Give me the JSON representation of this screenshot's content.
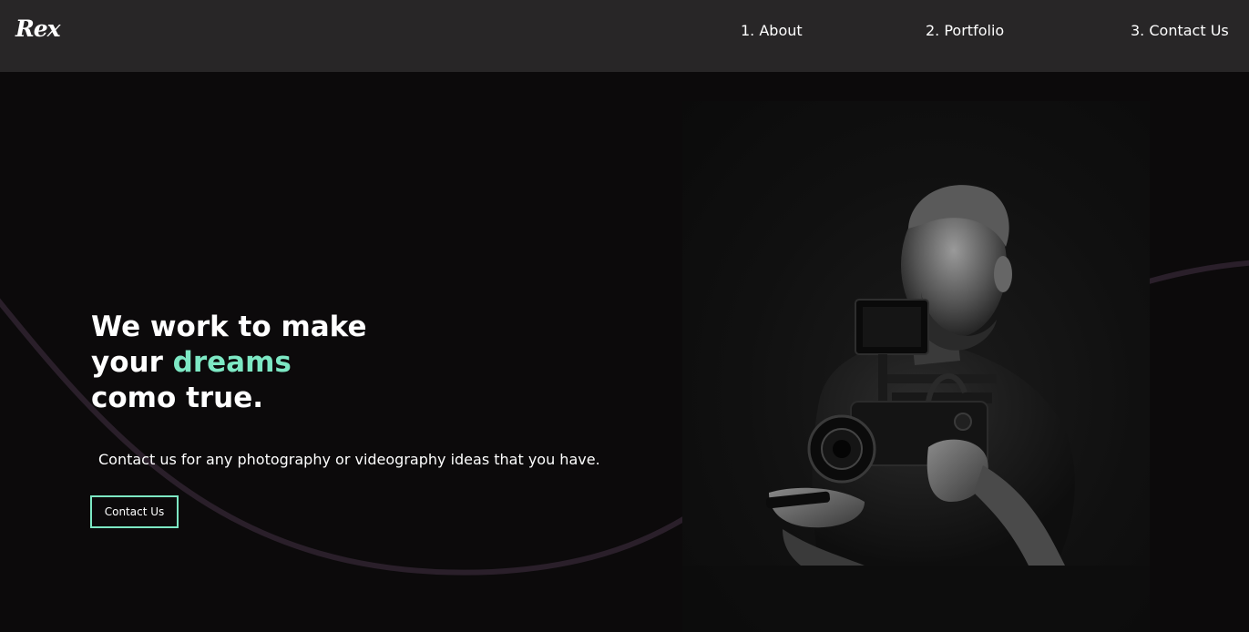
{
  "brand": {
    "logo_text": "Rex"
  },
  "nav": {
    "items": [
      {
        "label": "1. About"
      },
      {
        "label": "2. Portfolio"
      },
      {
        "label": "3. Contact Us"
      }
    ]
  },
  "hero": {
    "title_line1": "We work to make",
    "title_line2_prefix": "your ",
    "title_accent": "dreams",
    "title_line3": "como true.",
    "subtitle": "Contact us for any photography or videography ideas that you have.",
    "cta_label": "Contact Us"
  },
  "colors": {
    "accent": "#7de8c4",
    "navbar_bg": "#282627",
    "page_bg": "#0c0a0b",
    "curve": "#2a1f2a"
  },
  "hero_image": {
    "subject_icon": "videographer-photo"
  }
}
